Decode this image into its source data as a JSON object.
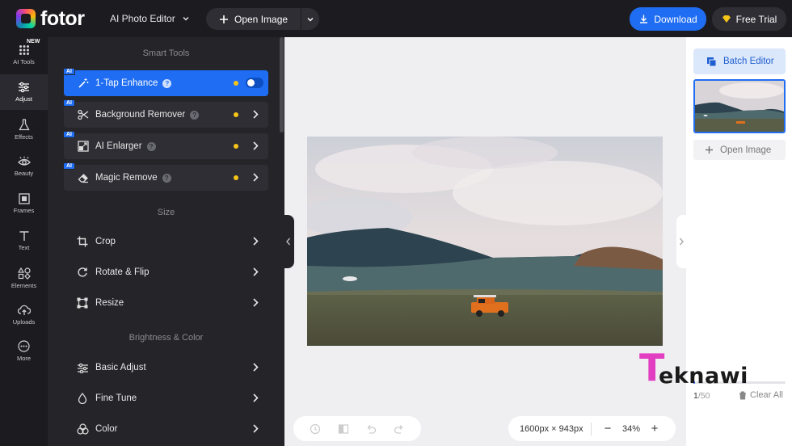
{
  "header": {
    "logo_text": "fotor",
    "product": "AI Photo Editor",
    "open_image": "Open Image",
    "download": "Download",
    "free_trial": "Free Trial"
  },
  "rail": {
    "new_badge": "NEW",
    "items": [
      {
        "label": "AI Tools",
        "icon": "grid-dots-icon"
      },
      {
        "label": "Adjust",
        "icon": "sliders-icon",
        "active": true
      },
      {
        "label": "Effects",
        "icon": "flask-icon"
      },
      {
        "label": "Beauty",
        "icon": "eye-icon"
      },
      {
        "label": "Frames",
        "icon": "frame-icon"
      },
      {
        "label": "Text",
        "icon": "text-icon"
      },
      {
        "label": "Elements",
        "icon": "shapes-icon"
      },
      {
        "label": "Uploads",
        "icon": "cloud-upload-icon"
      },
      {
        "label": "More",
        "icon": "more-icon"
      }
    ]
  },
  "panel": {
    "smart_tools_title": "Smart Tools",
    "ai_tag": "AI",
    "smart_tools": [
      {
        "label": "1-Tap Enhance",
        "active": true,
        "toggle": true
      },
      {
        "label": "Background Remover"
      },
      {
        "label": "AI Enlarger"
      },
      {
        "label": "Magic Remove"
      }
    ],
    "size_title": "Size",
    "size_tools": [
      {
        "label": "Crop",
        "icon": "crop-icon"
      },
      {
        "label": "Rotate & Flip",
        "icon": "rotate-icon"
      },
      {
        "label": "Resize",
        "icon": "resize-icon"
      }
    ],
    "brightness_title": "Brightness & Color",
    "color_tools": [
      {
        "label": "Basic Adjust",
        "icon": "sliders-icon"
      },
      {
        "label": "Fine Tune",
        "icon": "droplet-icon"
      },
      {
        "label": "Color",
        "icon": "color-circles-icon"
      }
    ]
  },
  "canvas": {
    "dimensions": "1600px × 943px",
    "zoom": "34%",
    "zoom_out": "−",
    "zoom_in": "+"
  },
  "right": {
    "batch_editor": "Batch Editor",
    "open_image": "Open Image",
    "counter_current": "1",
    "counter_total": "/50",
    "progress": 0.02,
    "clear_all": "Clear All"
  },
  "watermark": {
    "initial": "T",
    "text": "eknawi"
  },
  "colors": {
    "accent": "#1f6df2",
    "dark_bg": "#1c1c20",
    "panel_bg": "#252529",
    "badge_yellow": "#f5c518",
    "watermark_pink": "#e23ec2"
  }
}
